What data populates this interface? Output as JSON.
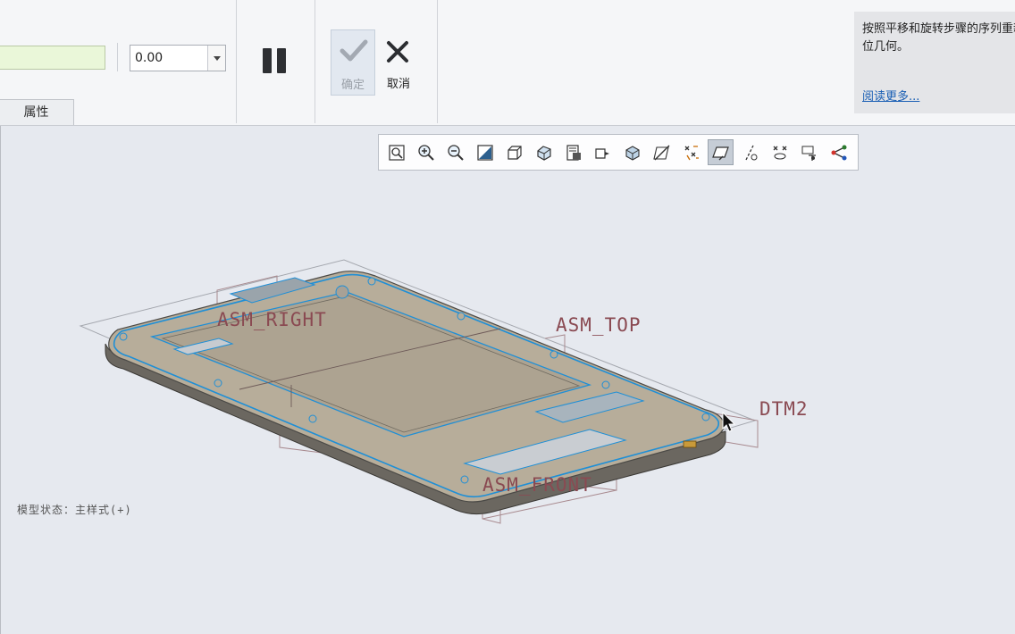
{
  "dashboard": {
    "value_field": "0.00",
    "properties_tab": "属性",
    "ok_label": "确定",
    "cancel_label": "取消"
  },
  "help": {
    "text": "按照平移和旋转步骤的序列重新定位几何。",
    "link": "阅读更多..."
  },
  "view_toolbar": {
    "tools": [
      {
        "icon": "refit-icon"
      },
      {
        "icon": "zoom-in-icon"
      },
      {
        "icon": "zoom-out-icon"
      },
      {
        "icon": "repaint-icon"
      },
      {
        "icon": "display-style-icon"
      },
      {
        "icon": "saved-orientations-icon"
      },
      {
        "icon": "view-manager-icon"
      },
      {
        "icon": "perspective-view-icon"
      },
      {
        "icon": "section-icon"
      },
      {
        "icon": "datum-display-filters-icon"
      },
      {
        "icon": "annotation-display-icon"
      },
      {
        "icon": "plane-display-icon",
        "active": true
      },
      {
        "icon": "axis-display-icon"
      },
      {
        "icon": "point-display-icon"
      },
      {
        "icon": "csys-display-icon"
      },
      {
        "icon": "spin-center-icon"
      }
    ]
  },
  "viewport": {
    "model_state": "模型状态：主样式(+)",
    "datums": {
      "right": "ASM_RIGHT",
      "top": "ASM_TOP",
      "dtm2": "DTM2",
      "front": "ASM_FRONT"
    }
  },
  "colors": {
    "viewport_bg": "#e6e9ef",
    "datum": "#8a4a52",
    "edge_highlight": "#1f8fd6",
    "part_fill": "#b5ab98"
  }
}
